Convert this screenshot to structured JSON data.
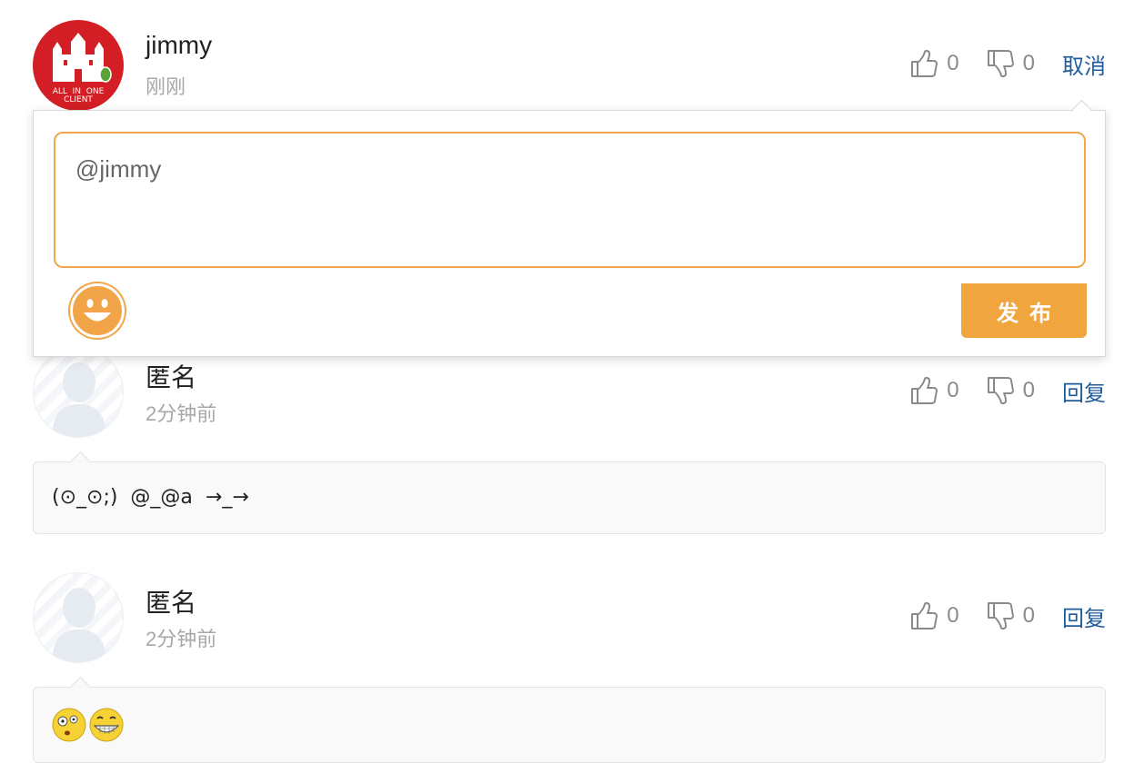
{
  "comments": [
    {
      "author": "jimmy",
      "time": "刚刚",
      "avatar_text": [
        "ALL",
        "IN",
        "ONE",
        "CLIENT"
      ],
      "likes": "0",
      "dislikes": "0",
      "action": "取消"
    },
    {
      "author": "匿名",
      "time": "2分钟前",
      "likes": "0",
      "dislikes": "0",
      "action": "回复",
      "content": "(⊙_⊙;)  @_@a  →_→"
    },
    {
      "author": "匿名",
      "time": "2分钟前",
      "likes": "0",
      "dislikes": "0",
      "action": "回复",
      "content": ""
    }
  ],
  "reply_box": {
    "value": "@jimmy",
    "publish_label": "发布"
  },
  "colors": {
    "accent": "#f0a53f",
    "link": "#1f5c9c",
    "avatar_red": "#d21e24"
  },
  "icons": [
    "thumbs-up-icon",
    "thumbs-down-icon",
    "smile-emoji-icon",
    "confused-emoji-icon",
    "grin-emoji-icon"
  ]
}
